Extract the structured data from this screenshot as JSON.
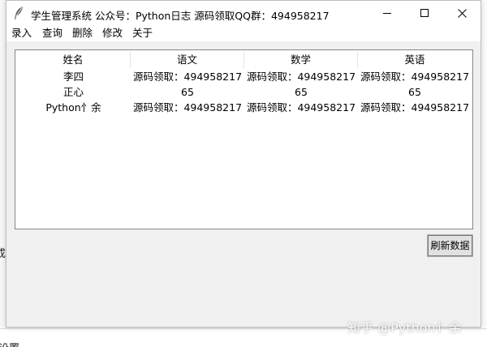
{
  "window": {
    "title": "学生管理系统 公众号：Python日志  源码领取QQ群：494958217"
  },
  "menu": {
    "items": [
      "录入",
      "查询",
      "删除",
      "修改",
      "关于"
    ]
  },
  "table": {
    "columns": [
      "姓名",
      "语文",
      "数学",
      "英语"
    ],
    "rows": [
      [
        "李四",
        "源码领取：494958217",
        "源码领取：494958217",
        "源码领取：494958217"
      ],
      [
        "正心",
        "65",
        "65",
        "65"
      ],
      [
        "Python忄余",
        "源码领取：494958217",
        "源码领取：494958217",
        "源码领取：494958217"
      ]
    ]
  },
  "buttons": {
    "refresh": "刷新数据"
  },
  "background": {
    "left_char": "成",
    "bottom_char": "设置"
  },
  "watermark": "知乎 @Python忄余",
  "colors": {
    "titlebar": "#ffffff",
    "window_bg": "#f0f0f0",
    "table_border": "#828790",
    "button_bg": "#e1e1e1"
  },
  "icons": {
    "app": "feather-icon",
    "minimize": "minimize-icon",
    "maximize": "maximize-icon",
    "close": "close-icon"
  }
}
